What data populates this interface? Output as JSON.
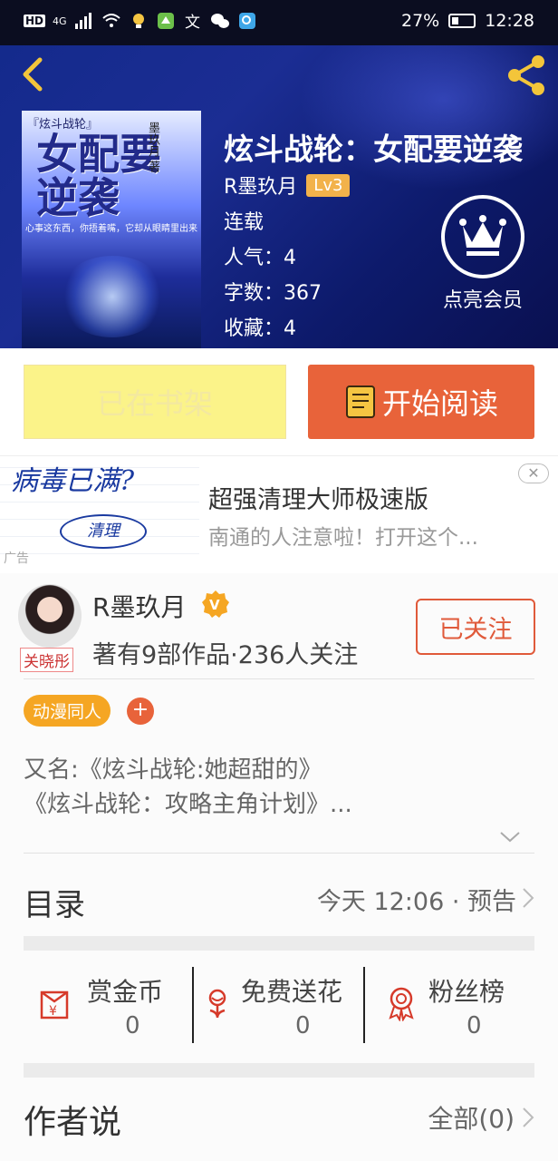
{
  "status_bar": {
    "left_labels": [
      "HD",
      "4G"
    ],
    "battery": "27%",
    "time": "12:28"
  },
  "book": {
    "title": "炫斗战轮：女配要逆袭",
    "author": "R墨玖月",
    "level": "Lv3",
    "status": "连载",
    "popularity": "人气：4",
    "word_count": "字数：367",
    "favorites": "收藏：4",
    "vip_label": "点亮会员",
    "cover": {
      "series": "『炫斗战轮』",
      "big_title": "女配要逆袭",
      "author": "墨玖月 著",
      "blurb": "心事这东西，你捂着嘴，它却从眼睛里出来"
    }
  },
  "actions": {
    "shelf_label": "已在书架",
    "read_label": "开始阅读"
  },
  "ad": {
    "image_text": "病毒已满?",
    "image_button": "清理",
    "ad_tag": "广告",
    "title": "超强清理大师极速版",
    "subtitle": "南通的人注意啦！打开这个...",
    "close_icon": "close-icon"
  },
  "author_card": {
    "name": "R墨玖月",
    "avatar_tag": "关晓彤",
    "stats": "著有9部作品·236人关注",
    "follow_label": "已关注",
    "tag": "动漫同人",
    "tag_add": "+",
    "alias_line1": "又名:《炫斗战轮:她超甜的》",
    "alias_line2": "《炫斗战轮：攻略主角计划》..."
  },
  "toc": {
    "label": "目录",
    "update": "今天 12:06 · 预告"
  },
  "gifts": [
    {
      "label": "赏金币",
      "count": "0",
      "icon": "coin-icon"
    },
    {
      "label": "免费送花",
      "count": "0",
      "icon": "flower-icon"
    },
    {
      "label": "粉丝榜",
      "count": "0",
      "icon": "medal-icon"
    }
  ],
  "author_says": {
    "label": "作者说",
    "all": "全部(0)"
  },
  "colors": {
    "accent": "#e8633a",
    "hero_bg": "#1b2d93",
    "shelf_button": "#fbf389",
    "tag": "#f5a623"
  }
}
